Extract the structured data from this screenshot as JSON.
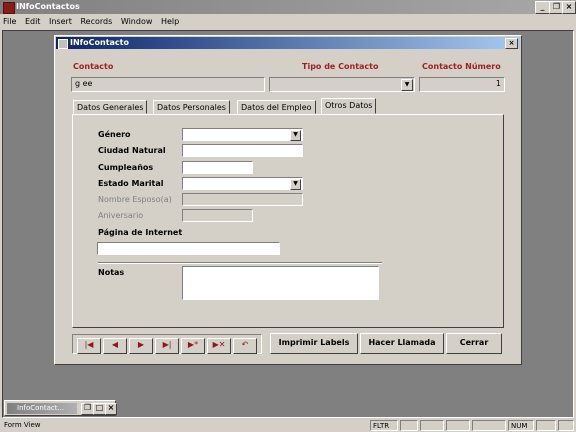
{
  "app": {
    "title": "INfoContactos"
  },
  "menu": [
    "File",
    "Edit",
    "Insert",
    "Records",
    "Window",
    "Help"
  ],
  "form": {
    "title": "INfoContacto",
    "headers": {
      "contacto": "Contacto",
      "tipo": "Tipo de Contacto",
      "numero": "Contacto Número"
    },
    "values": {
      "contacto": "g ee",
      "tipo": "",
      "numero": "1"
    },
    "tabs": [
      "Datos Generales",
      "Datos Personales",
      "Datos del Empleo",
      "Otros Datos"
    ],
    "active_tab": "Otros Datos",
    "fields": {
      "genero": "Género",
      "ciudad": "Ciudad Natural",
      "cumple": "Cumpleaños",
      "estado": "Estado Marital",
      "esposo": "Nombre Esposo(a)",
      "aniversario": "Aniversario",
      "pagina": "Página de Internet",
      "notas": "Notas"
    },
    "nav_icons": [
      "first-record-icon",
      "prev-record-icon",
      "next-record-icon",
      "last-record-icon",
      "new-record-icon",
      "delete-record-icon",
      "undo-icon"
    ],
    "buttons": {
      "imprimir": "Imprimir Labels",
      "llamada": "Hacer Llamada",
      "cerrar": "Cerrar"
    }
  },
  "minimized": {
    "title": "InfoContact..."
  },
  "status": {
    "left": "Form View",
    "fltr": "FLTR",
    "num": "NUM"
  },
  "colors": {
    "label_red": "#a02020",
    "title_blue": "#0a246a"
  }
}
